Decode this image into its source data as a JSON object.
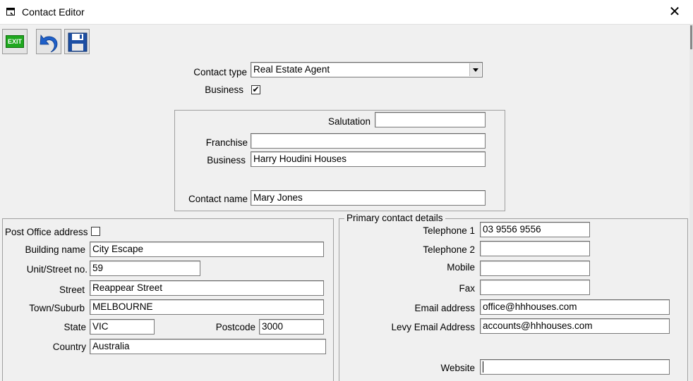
{
  "window": {
    "title": "Contact Editor"
  },
  "toolbar": {
    "exit_label": "EXIT"
  },
  "contact_type": {
    "label": "Contact type",
    "value": "Real Estate Agent"
  },
  "business_flag": {
    "label": "Business",
    "checked_glyph": "✔"
  },
  "name_group": {
    "salutation": {
      "label": "Salutation",
      "value": ""
    },
    "franchise": {
      "label": "Franchise",
      "value": ""
    },
    "business": {
      "label": "Business",
      "value": "Harry Houdini Houses"
    },
    "contact_name": {
      "label": "Contact name",
      "value": "Mary Jones"
    }
  },
  "address": {
    "po_label": "Post Office address",
    "building": {
      "label": "Building name",
      "value": "City Escape"
    },
    "unit": {
      "label": "Unit/Street no.",
      "value": "59"
    },
    "street": {
      "label": "Street",
      "value": "Reappear Street"
    },
    "town": {
      "label": "Town/Suburb",
      "value": "MELBOURNE"
    },
    "state": {
      "label": "State",
      "value": "VIC"
    },
    "postcode": {
      "label": "Postcode",
      "value": "3000"
    },
    "country": {
      "label": "Country",
      "value": "Australia"
    }
  },
  "contact_details": {
    "legend": "Primary contact details",
    "telephone1": {
      "label": "Telephone 1",
      "value": "03 9556 9556"
    },
    "telephone2": {
      "label": "Telephone 2",
      "value": ""
    },
    "mobile": {
      "label": "Mobile",
      "value": ""
    },
    "fax": {
      "label": "Fax",
      "value": ""
    },
    "email": {
      "label": "Email address",
      "value": "office@hhhouses.com"
    },
    "levy_email": {
      "label": "Levy Email Address",
      "value": "accounts@hhhouses.com"
    },
    "website": {
      "label": "Website",
      "value": ""
    }
  },
  "colors": {
    "exit_green": "#1fa81f",
    "undo_blue": "#1e5fc8",
    "save_blue": "#1d4fa3"
  },
  "icons": [
    "window-app-icon",
    "close-icon",
    "exit-icon",
    "undo-icon",
    "save-icon",
    "dropdown-arrow-icon",
    "checkmark-icon"
  ]
}
